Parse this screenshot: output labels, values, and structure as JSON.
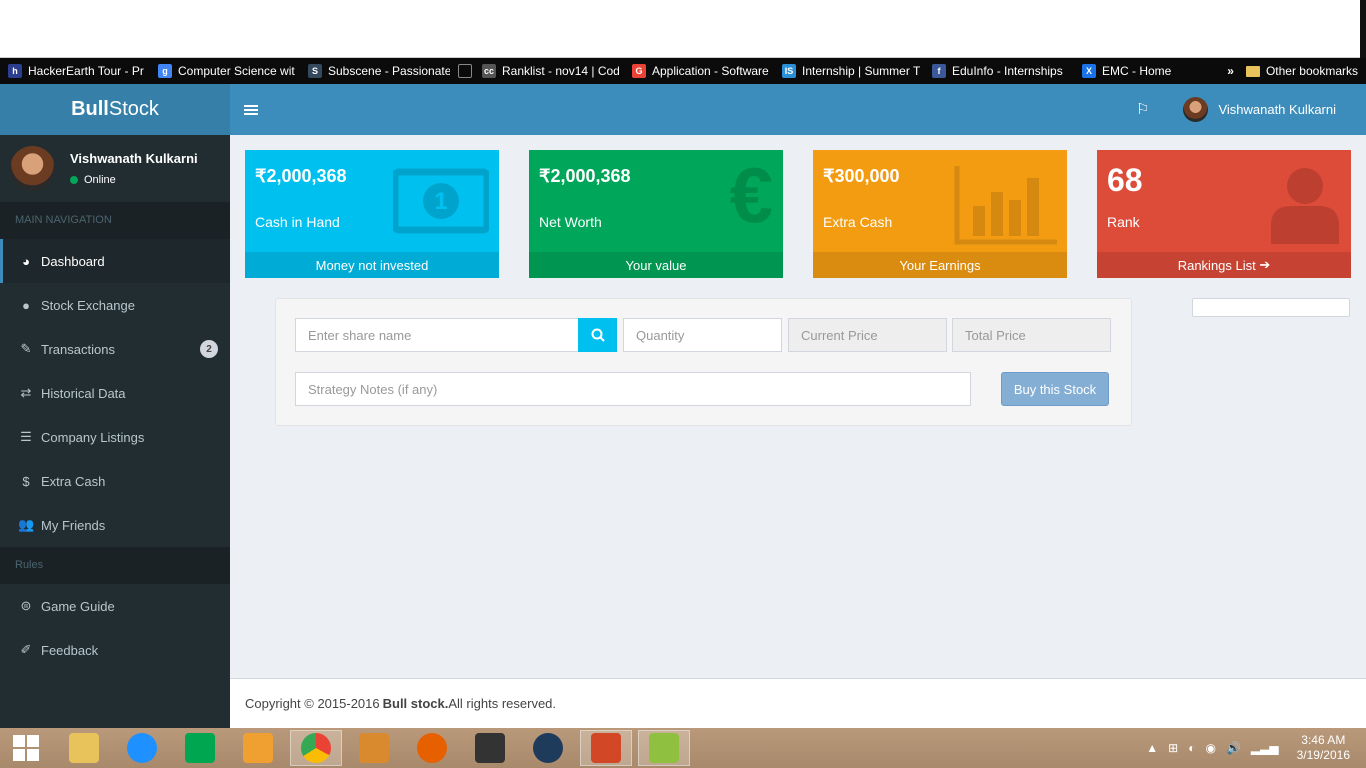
{
  "browser": {
    "bookmarks": [
      {
        "label": "HackerEarth Tour - Pr",
        "color": "#2c3e8f",
        "glyph": "h"
      },
      {
        "label": "Computer Science wit",
        "color": "#4285f4",
        "glyph": "g"
      },
      {
        "label": "Subscene - Passionate",
        "color": "#34495e",
        "glyph": "S"
      },
      {
        "label": "",
        "color": "#0b0b0b",
        "glyph": ""
      },
      {
        "label": "Ranklist - nov14 | Cod",
        "color": "#555555",
        "glyph": "cc"
      },
      {
        "label": "Application - Software",
        "color": "#ea4335",
        "glyph": "G"
      },
      {
        "label": "Internship | Summer T",
        "color": "#2a8fd6",
        "glyph": "IS"
      },
      {
        "label": "EduInfo - Internships",
        "color": "#3b5998",
        "glyph": "f"
      },
      {
        "label": "EMC - Home",
        "color": "#1a73e8",
        "glyph": "X"
      }
    ],
    "more": "»",
    "other_bookmarks": "Other bookmarks"
  },
  "app": {
    "logo_bold": "Bull",
    "logo_rest": "Stock",
    "user_name": "Vishwanath Kulkarni",
    "user_status": "Online",
    "main_nav_header": "MAIN NAVIGATION",
    "rules_header": "Rules",
    "nav": [
      {
        "label": "Dashboard",
        "icon": "dashboard-icon",
        "glyph": "◕"
      },
      {
        "label": "Stock Exchange",
        "icon": "globe-icon",
        "glyph": "●"
      },
      {
        "label": "Transactions",
        "icon": "edit-icon",
        "glyph": "✎",
        "badge": "2"
      },
      {
        "label": "Historical Data",
        "icon": "exchange-icon",
        "glyph": "⇄"
      },
      {
        "label": "Company Listings",
        "icon": "list-icon",
        "glyph": "☰"
      },
      {
        "label": "Extra Cash",
        "icon": "dollar-icon",
        "glyph": "$"
      },
      {
        "label": "My Friends",
        "icon": "users-icon",
        "glyph": "👥"
      }
    ],
    "rules_nav": [
      {
        "label": "Game Guide",
        "icon": "gamepad-icon",
        "glyph": "⊜"
      },
      {
        "label": "Feedback",
        "icon": "pencil-icon",
        "glyph": "✐"
      }
    ]
  },
  "topbar": {
    "user_name": "Vishwanath Kulkarni"
  },
  "boxes": [
    {
      "value": "₹2,000,368",
      "label": "Cash in Hand",
      "footer": "Money not invested",
      "color": "#00c0ef",
      "icon": "money-icon"
    },
    {
      "value": "₹2,000,368",
      "label": "Net Worth",
      "footer": "Your value",
      "color": "#00a65a",
      "icon": "euro-icon"
    },
    {
      "value": "₹300,000",
      "label": "Extra Cash",
      "footer": "Your Earnings",
      "color": "#f39c12",
      "icon": "bar-chart-icon"
    },
    {
      "value": "68",
      "label": "Rank",
      "footer": "Rankings List",
      "color": "#dd4b39",
      "icon": "user-icon"
    }
  ],
  "form": {
    "share_placeholder": "Enter share name",
    "quantity_placeholder": "Quantity",
    "current_price_placeholder": "Current Price",
    "total_price_placeholder": "Total Price",
    "notes_placeholder": "Strategy Notes (if any)",
    "buy_label": "Buy this Stock"
  },
  "footer": {
    "text": "Copyright © 2015-2016",
    "brand": "Bull stock.",
    "rest": "All rights reserved."
  },
  "taskbar": {
    "time": "3:46 AM",
    "date": "3/19/2016"
  }
}
